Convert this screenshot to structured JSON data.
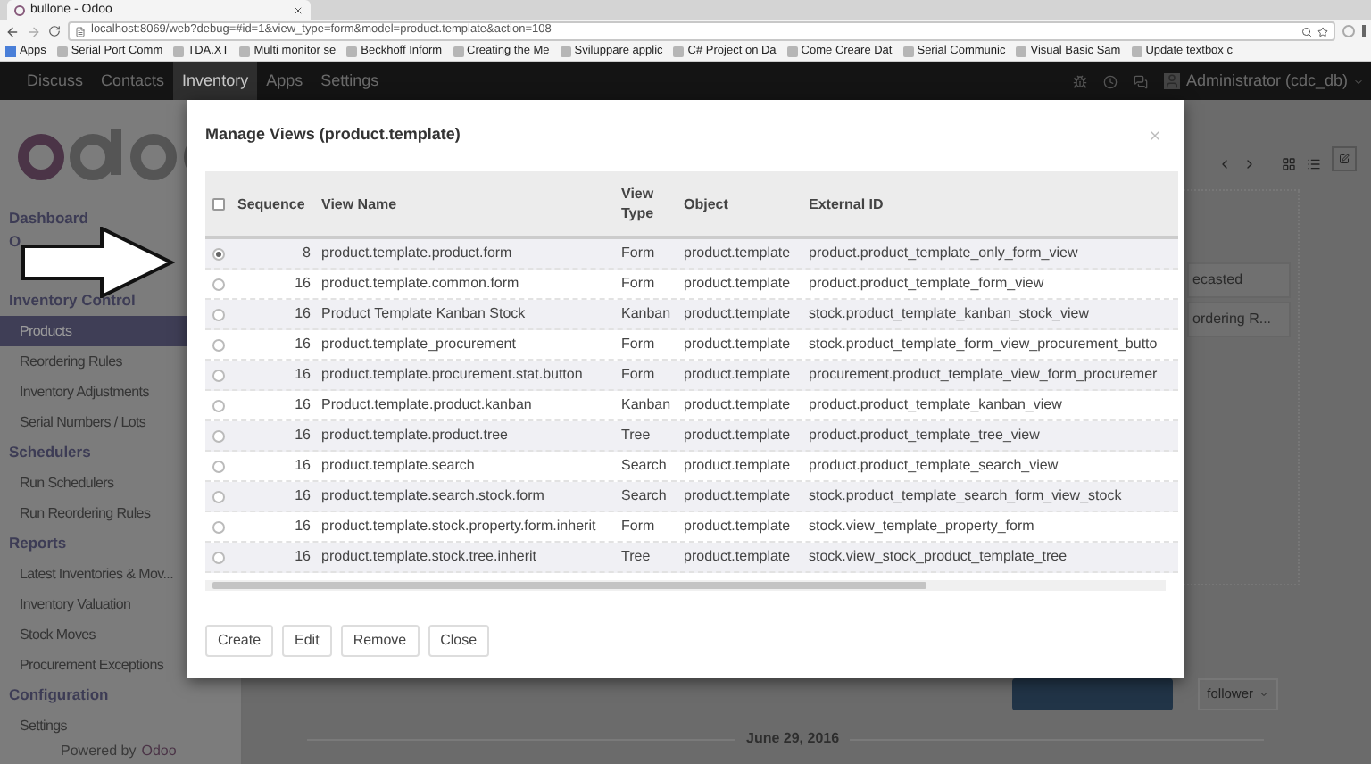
{
  "browser": {
    "tab_title": "bullone - Odoo",
    "address": "localhost:8069/web?debug=#id=1&view_type=form&model=product.template&action=108",
    "bookmarks": [
      "Apps",
      "Serial Port Comm",
      "TDA.XT",
      "Multi monitor se",
      "Beckhoff Inform",
      "Creating the Me",
      "Sviluppare applic",
      "C# Project on Da",
      "Come Creare Dat",
      "Serial Communic",
      "Visual Basic Sam",
      "Update textbox c"
    ]
  },
  "navbar": {
    "menu": [
      {
        "label": "Discuss",
        "selected": false
      },
      {
        "label": "Contacts",
        "selected": false
      },
      {
        "label": "Inventory",
        "selected": true
      },
      {
        "label": "Apps",
        "selected": false
      },
      {
        "label": "Settings",
        "selected": false
      }
    ],
    "user": "Administrator (cdc_db)"
  },
  "sidebar": {
    "sections": [
      {
        "title": "Dashboard"
      },
      {
        "title": "O"
      },
      {
        "title": "Inventory Control",
        "items": [
          {
            "label": "Products",
            "selected": true
          },
          {
            "label": "Reordering Rules",
            "selected": false
          },
          {
            "label": "Inventory Adjustments",
            "selected": false
          },
          {
            "label": "Serial Numbers / Lots",
            "selected": false
          }
        ]
      },
      {
        "title": "Schedulers",
        "items": [
          {
            "label": "Run Schedulers",
            "selected": false
          },
          {
            "label": "Run Reordering Rules",
            "selected": false
          }
        ]
      },
      {
        "title": "Reports",
        "items": [
          {
            "label": "Latest Inventories & Mov...",
            "selected": false
          },
          {
            "label": "Inventory Valuation",
            "selected": false
          },
          {
            "label": "Stock Moves",
            "selected": false
          },
          {
            "label": "Procurement Exceptions",
            "selected": false
          }
        ]
      },
      {
        "title": "Configuration",
        "items": [
          {
            "label": "Settings",
            "selected": false
          }
        ]
      }
    ],
    "powered_by": {
      "text": "Powered by",
      "brand": "Odoo"
    }
  },
  "background": {
    "cards": [
      "ecasted",
      "ordering R..."
    ],
    "follow_button": "follower",
    "date": "June 29, 2016"
  },
  "modal": {
    "title": "Manage Views (product.template)",
    "select_all_checked": false,
    "columns": [
      "Sequence",
      "View Name",
      "View Type",
      "Object",
      "External ID"
    ],
    "rows": [
      {
        "selected": true,
        "sequence": "8",
        "view_name": "product.template.product.form",
        "view_type": "Form",
        "object": "product.template",
        "external_id": "product.product_template_only_form_view"
      },
      {
        "selected": false,
        "sequence": "16",
        "view_name": "product.template.common.form",
        "view_type": "Form",
        "object": "product.template",
        "external_id": "product.product_template_form_view"
      },
      {
        "selected": false,
        "sequence": "16",
        "view_name": "Product Template Kanban Stock",
        "view_type": "Kanban",
        "object": "product.template",
        "external_id": "stock.product_template_kanban_stock_view"
      },
      {
        "selected": false,
        "sequence": "16",
        "view_name": "product.template_procurement",
        "view_type": "Form",
        "object": "product.template",
        "external_id": "stock.product_template_form_view_procurement_butto"
      },
      {
        "selected": false,
        "sequence": "16",
        "view_name": "product.template.procurement.stat.button",
        "view_type": "Form",
        "object": "product.template",
        "external_id": "procurement.product_template_view_form_procuremer"
      },
      {
        "selected": false,
        "sequence": "16",
        "view_name": "Product.template.product.kanban",
        "view_type": "Kanban",
        "object": "product.template",
        "external_id": "product.product_template_kanban_view"
      },
      {
        "selected": false,
        "sequence": "16",
        "view_name": "product.template.product.tree",
        "view_type": "Tree",
        "object": "product.template",
        "external_id": "product.product_template_tree_view"
      },
      {
        "selected": false,
        "sequence": "16",
        "view_name": "product.template.search",
        "view_type": "Search",
        "object": "product.template",
        "external_id": "product.product_template_search_view"
      },
      {
        "selected": false,
        "sequence": "16",
        "view_name": "product.template.search.stock.form",
        "view_type": "Search",
        "object": "product.template",
        "external_id": "stock.product_template_search_form_view_stock"
      },
      {
        "selected": false,
        "sequence": "16",
        "view_name": "product.template.stock.property.form.inherit",
        "view_type": "Form",
        "object": "product.template",
        "external_id": "stock.view_template_property_form"
      },
      {
        "selected": false,
        "sequence": "16",
        "view_name": "product.template.stock.tree.inherit",
        "view_type": "Tree",
        "object": "product.template",
        "external_id": "stock.view_stock_product_template_tree"
      }
    ],
    "buttons": [
      "Create",
      "Edit",
      "Remove",
      "Close"
    ]
  }
}
